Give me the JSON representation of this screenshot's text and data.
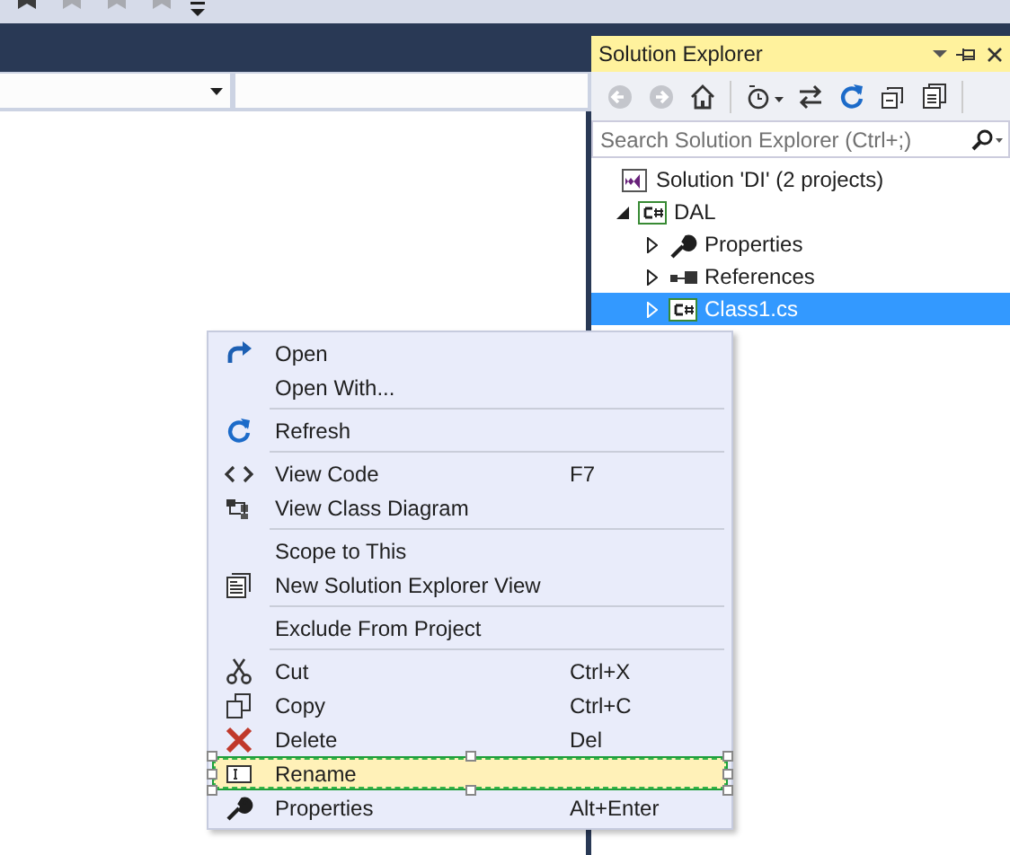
{
  "solution_explorer": {
    "title": "Solution Explorer",
    "search": {
      "placeholder": "Search Solution Explorer (Ctrl+;)"
    },
    "tree": [
      {
        "kind": "solution",
        "label": "Solution 'DI' (2 projects)",
        "selected": false
      },
      {
        "kind": "project",
        "label": "DAL",
        "expanded": true,
        "selected": false,
        "children": [
          {
            "kind": "properties",
            "label": "Properties",
            "expanded": false,
            "selected": false
          },
          {
            "kind": "references",
            "label": "References",
            "expanded": false,
            "selected": false
          },
          {
            "kind": "file",
            "label": "Class1.cs",
            "expanded": false,
            "selected": true
          }
        ]
      }
    ]
  },
  "context_menu": {
    "items": [
      {
        "kind": "item",
        "label": "Open",
        "selected": false
      },
      {
        "kind": "item",
        "label": "Open With...",
        "selected": false
      },
      {
        "kind": "separator"
      },
      {
        "kind": "item",
        "label": "Refresh",
        "selected": false
      },
      {
        "kind": "separator"
      },
      {
        "kind": "item",
        "label": "View Code",
        "shortcut": "F7",
        "selected": false
      },
      {
        "kind": "item",
        "label": "View Class Diagram",
        "selected": false
      },
      {
        "kind": "separator"
      },
      {
        "kind": "item",
        "label": "Scope to This",
        "selected": false
      },
      {
        "kind": "item",
        "label": "New Solution Explorer View",
        "selected": false
      },
      {
        "kind": "separator"
      },
      {
        "kind": "item",
        "label": "Exclude From Project",
        "selected": false
      },
      {
        "kind": "separator"
      },
      {
        "kind": "item",
        "label": "Cut",
        "shortcut": "Ctrl+X",
        "selected": false
      },
      {
        "kind": "item",
        "label": "Copy",
        "shortcut": "Ctrl+C",
        "selected": false
      },
      {
        "kind": "item",
        "label": "Delete",
        "shortcut": "Del",
        "selected": false
      },
      {
        "kind": "item",
        "label": "Rename",
        "selected": true
      },
      {
        "kind": "item",
        "label": "Properties",
        "shortcut": "Alt+Enter",
        "selected": false
      }
    ]
  }
}
